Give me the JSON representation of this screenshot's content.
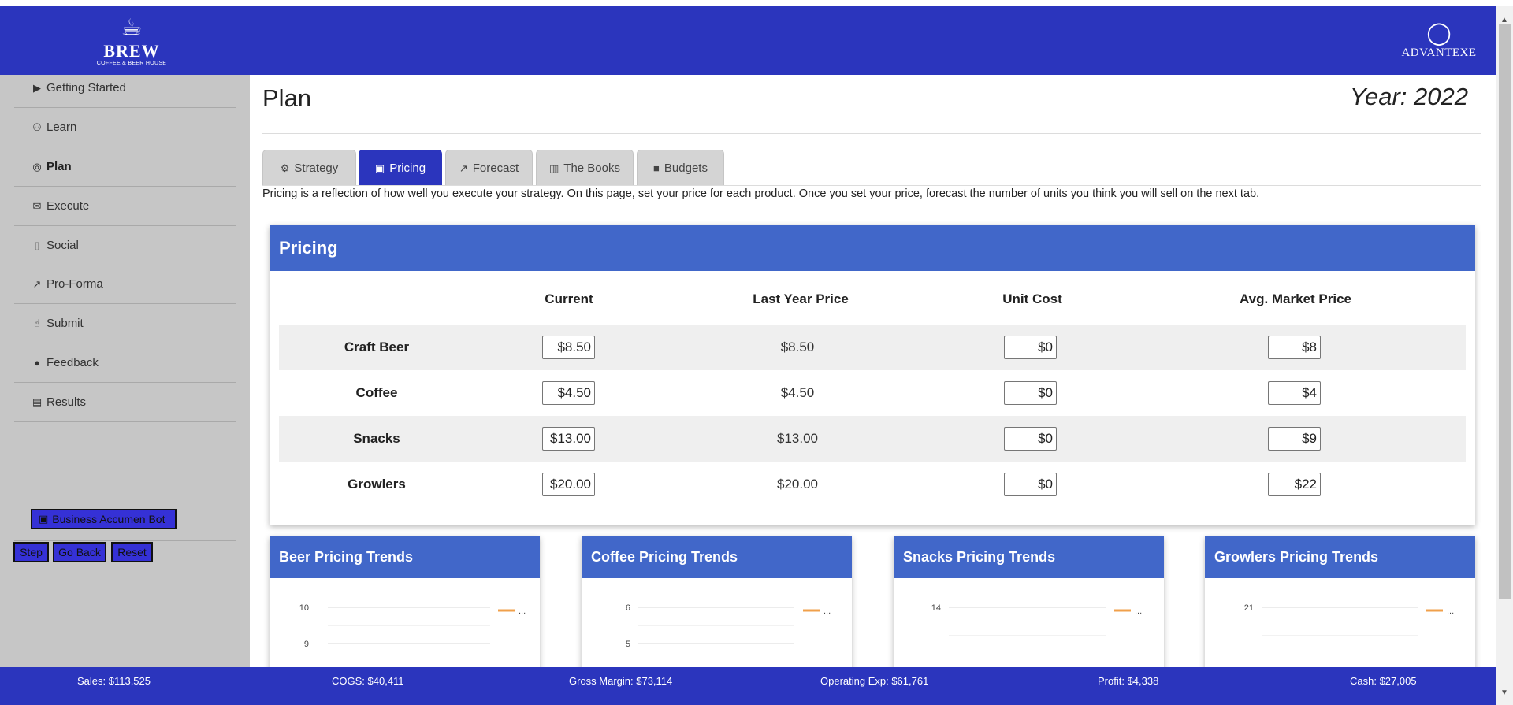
{
  "brand": {
    "logo_main": "BREW",
    "logo_sub": "COFFEE & BEER HOUSE",
    "partner": "ADVANTEXE"
  },
  "sidebar": {
    "items": [
      {
        "label": "Getting Started",
        "icon": "play-circle-icon",
        "glyph": "▶"
      },
      {
        "label": "Learn",
        "icon": "lightbulb-icon",
        "glyph": "⚇"
      },
      {
        "label": "Plan",
        "icon": "target-icon",
        "glyph": "◎"
      },
      {
        "label": "Execute",
        "icon": "envelope-icon",
        "glyph": "✉"
      },
      {
        "label": "Social",
        "icon": "mobile-icon",
        "glyph": "▯"
      },
      {
        "label": "Pro-Forma",
        "icon": "line-chart-icon",
        "glyph": "↗"
      },
      {
        "label": "Submit",
        "icon": "hand-pointer-icon",
        "glyph": "☝"
      },
      {
        "label": "Feedback",
        "icon": "comment-icon",
        "glyph": "●"
      },
      {
        "label": "Results",
        "icon": "report-icon",
        "glyph": "▤"
      }
    ],
    "bot_label": "Business Accumen Bot",
    "bot_glyph": "▣",
    "step_label": "Step",
    "go_back_label": "Go Back",
    "reset_label": "Reset"
  },
  "main": {
    "title": "Plan",
    "year": "Year: 2022",
    "tabs": [
      {
        "label": "Strategy",
        "icon": "users-cog-icon",
        "glyph": "⚙"
      },
      {
        "label": "Pricing",
        "icon": "money-bill-icon",
        "glyph": "▣"
      },
      {
        "label": "Forecast",
        "icon": "chart-line-icon",
        "glyph": "↗"
      },
      {
        "label": "The Books",
        "icon": "book-icon",
        "glyph": "▥"
      },
      {
        "label": "Budgets",
        "icon": "wallet-icon",
        "glyph": "■"
      }
    ],
    "description": "Pricing is a reflection of how well you execute your strategy. On this page, set your price for each product. Once you set your price, forecast the number of units you think you will sell on the next tab."
  },
  "pricing": {
    "title": "Pricing",
    "columns": [
      "Current",
      "Last Year Price",
      "Unit Cost",
      "Avg. Market Price"
    ],
    "rows": [
      {
        "product": "Craft Beer",
        "current": "$8.50",
        "last_year": "$8.50",
        "unit_cost": "$0",
        "market": "$8"
      },
      {
        "product": "Coffee",
        "current": "$4.50",
        "last_year": "$4.50",
        "unit_cost": "$0",
        "market": "$4"
      },
      {
        "product": "Snacks",
        "current": "$13.00",
        "last_year": "$13.00",
        "unit_cost": "$0",
        "market": "$9"
      },
      {
        "product": "Growlers",
        "current": "$20.00",
        "last_year": "$20.00",
        "unit_cost": "$0",
        "market": "$22"
      }
    ]
  },
  "trends": [
    {
      "title": "Beer Pricing Trends",
      "ticks": [
        "10",
        "9"
      ],
      "legend": "..."
    },
    {
      "title": "Coffee Pricing Trends",
      "ticks": [
        "6",
        "5"
      ],
      "legend": "..."
    },
    {
      "title": "Snacks Pricing Trends",
      "ticks": [
        "14"
      ],
      "legend": "..."
    },
    {
      "title": "Growlers Pricing Trends",
      "ticks": [
        "21"
      ],
      "legend": "..."
    }
  ],
  "footer": {
    "sales": "Sales: $113,525",
    "cogs": "COGS: $40,411",
    "gross_margin": "Gross Margin: $73,114",
    "operating_exp": "Operating Exp: $61,761",
    "profit": "Profit: $4,338",
    "cash": "Cash: $27,005"
  },
  "colors": {
    "header_blue": "#2b35bd",
    "card_blue": "#4167c9",
    "sidebar_gray": "#c6c6c6",
    "legend_orange": "#f0a04b"
  }
}
